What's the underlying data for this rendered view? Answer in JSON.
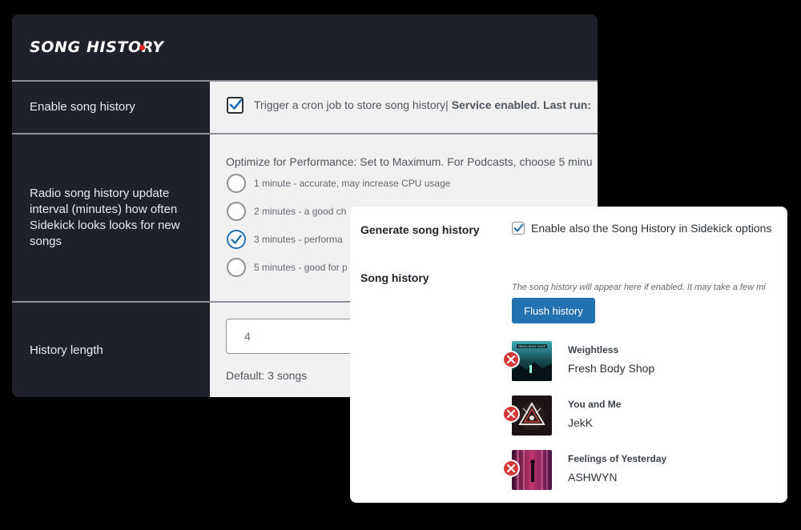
{
  "settings_panel": {
    "title": "SONG HISTORY",
    "rows": {
      "enable": {
        "label": "Enable song history",
        "checked": true,
        "checkbox_text": "Trigger a cron job to store song history|",
        "status_text": "Service enabled. Last run:"
      },
      "interval": {
        "label": "Radio song history update interval (minutes) how often Sidekick looks looks for new songs",
        "description": "Optimize for Performance: Set to Maximum. For Podcasts, choose 5 minu",
        "options": [
          {
            "label": "1 minute - accurate, may increase CPU usage",
            "selected": false
          },
          {
            "label": "2 minutes - a good ch",
            "selected": false
          },
          {
            "label": "3 minutes - performa",
            "selected": true
          },
          {
            "label": "5 minutes - good for p",
            "selected": false
          }
        ]
      },
      "length": {
        "label": "History length",
        "value": "4",
        "default_text": "Default: 3 songs"
      }
    }
  },
  "sidekick_panel": {
    "generate_label": "Generate song history",
    "generate_checked": true,
    "generate_checkbox_text": "Enable also the Song History in Sidekick options",
    "song_history_label": "Song history",
    "note": "The song history will appear here if enabled. It may take a few mi",
    "flush_button": "Flush history",
    "songs": [
      {
        "title": "Weightless",
        "artist": "Fresh Body Shop",
        "cover_text": "FRESH BODY SHOP"
      },
      {
        "title": "You and Me",
        "artist": "JekK"
      },
      {
        "title": "Feelings of Yesterday",
        "artist": "ASHWYN"
      }
    ]
  },
  "colors": {
    "accent": "#2271b1",
    "dark_bg": "#1e212a",
    "delete": "#d63638",
    "title_dot": "#e5251e"
  }
}
